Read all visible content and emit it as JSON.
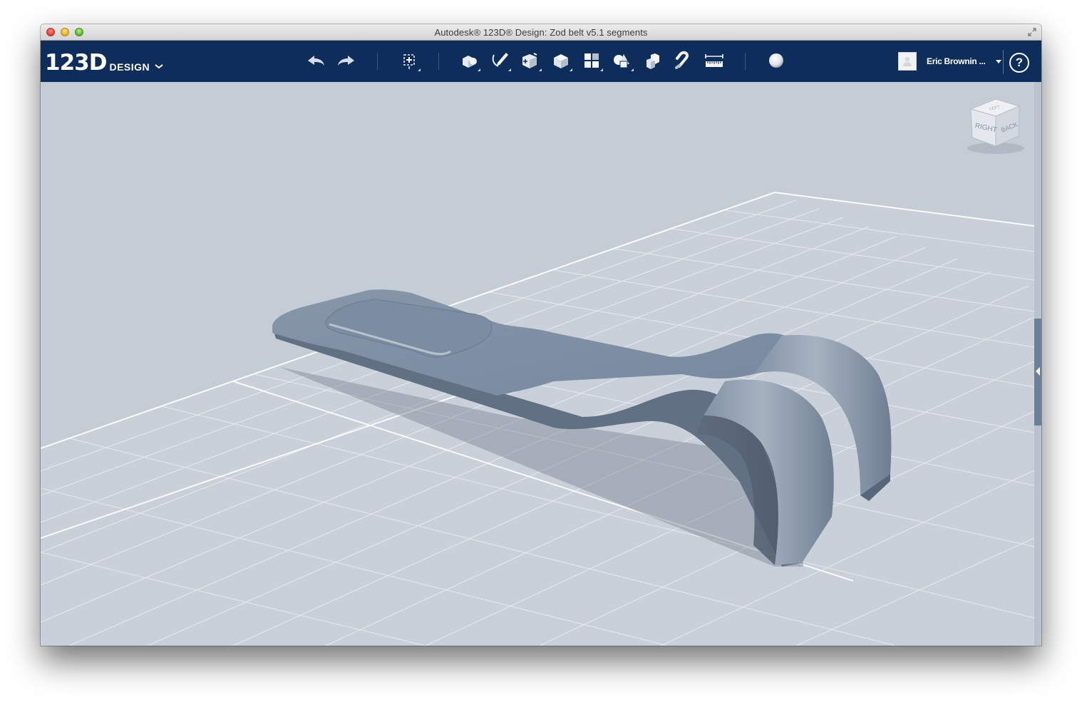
{
  "window": {
    "title": "Autodesk® 123D® Design: Zod belt v5.1 segments"
  },
  "toolbar": {
    "logo_number": "123D",
    "logo_word": "DESIGN",
    "buttons": [
      {
        "name": "undo",
        "icon": "undo-arrow-icon"
      },
      {
        "name": "redo",
        "icon": "redo-arrow-icon"
      },
      {
        "name": "transform",
        "icon": "transform-icon"
      },
      {
        "name": "primitives",
        "icon": "primitives-icon"
      },
      {
        "name": "sketch",
        "icon": "sketch-icon"
      },
      {
        "name": "construct",
        "icon": "construct-icon"
      },
      {
        "name": "modify",
        "icon": "modify-icon"
      },
      {
        "name": "pattern",
        "icon": "pattern-icon"
      },
      {
        "name": "grouping",
        "icon": "grouping-icon"
      },
      {
        "name": "combine",
        "icon": "combine-icon"
      },
      {
        "name": "snap",
        "icon": "snap-magnet-icon"
      },
      {
        "name": "measure",
        "icon": "measure-ruler-icon"
      },
      {
        "name": "material",
        "icon": "material-sphere-icon"
      }
    ]
  },
  "user": {
    "name": "Eric Brownin ...",
    "help_label": "?"
  },
  "viewcube": {
    "right_label": "RIGHT",
    "back_label": "BACK",
    "top_label": "LEFT"
  },
  "colors": {
    "toolbar_bg": "#0f2d5b",
    "viewport_bg": "#c4ccd5",
    "model_color": "#7f8fa2",
    "grid_color": "#ffffff"
  }
}
